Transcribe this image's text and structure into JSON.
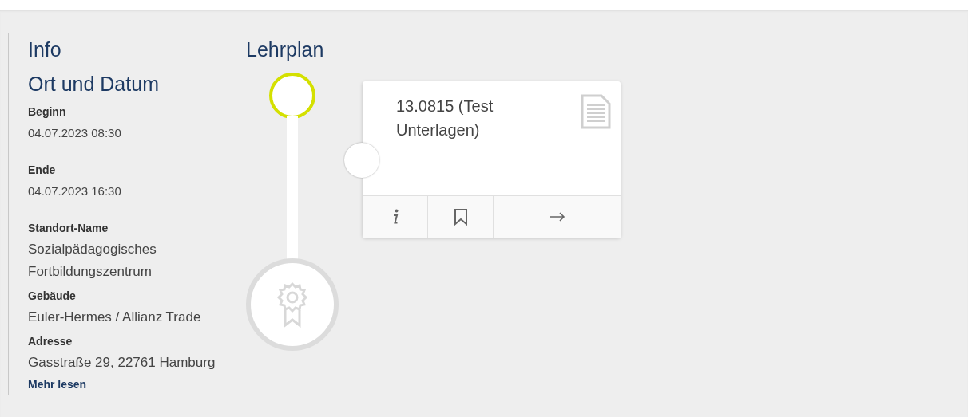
{
  "info": {
    "heading": "Info",
    "section_title": "Ort und Datum",
    "fields": [
      {
        "label": "Beginn",
        "kind": "date",
        "lines": [
          "04.07.2023 08:30"
        ]
      },
      {
        "label": "Ende",
        "kind": "date",
        "lines": [
          "04.07.2023 16:30"
        ]
      },
      {
        "label": "Standort-Name",
        "kind": "text",
        "lines": [
          "Sozialpädagogisches",
          "Fortbildungszentrum"
        ]
      },
      {
        "label": "Gebäude",
        "kind": "text",
        "lines": [
          "Euler-Hermes / Allianz Trade"
        ]
      },
      {
        "label": "Adresse",
        "kind": "text",
        "lines": [
          "Gasstraße 29, 22761 Hamburg"
        ]
      }
    ],
    "link": "Mehr lesen"
  },
  "lehrplan": {
    "heading": "Lehrplan",
    "start_highlighted": true,
    "modules": [
      {
        "title": "13.0815 (Test Unterlagen)",
        "kind": "document"
      }
    ]
  }
}
